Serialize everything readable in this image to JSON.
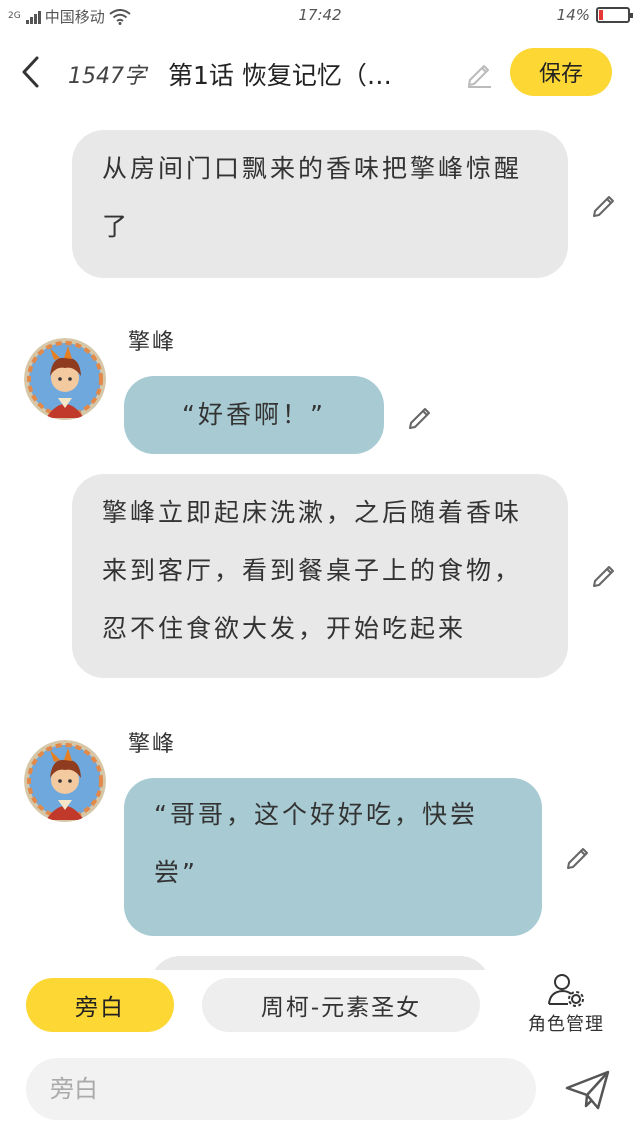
{
  "status_bar": {
    "network_type": "2G",
    "carrier": "中国移动",
    "time": "17:42",
    "battery_percent_label": "14%",
    "battery_level": 0.14,
    "battery_color": "#e53935"
  },
  "header": {
    "back_icon": "chevron-left-icon",
    "word_count": "1547字",
    "title": "第1话  恢复记忆（…",
    "edit_icon": "pencil-icon",
    "save_label": "保存",
    "accent_color": "#fdd835"
  },
  "messages": [
    {
      "type": "narration",
      "text": "从房间门口飘来的香味把擎峰惊醒了"
    },
    {
      "type": "dialogue",
      "speaker": "擎峰",
      "text": "“好香啊！”"
    },
    {
      "type": "narration",
      "text": "擎峰立即起床洗漱，之后随着香味来到客厅，看到餐桌子上的食物，忍不住食欲大发，开始吃起来"
    },
    {
      "type": "dialogue",
      "speaker": "擎峰",
      "text": "“哥哥，这个好好吃，快尝尝”"
    }
  ],
  "roles": {
    "narrator_label": "旁白",
    "character_label": "周柯-元素圣女",
    "manage_label": "角色管理",
    "manage_icon": "user-gear-icon"
  },
  "input": {
    "placeholder": "旁白",
    "send_icon": "send-icon"
  }
}
